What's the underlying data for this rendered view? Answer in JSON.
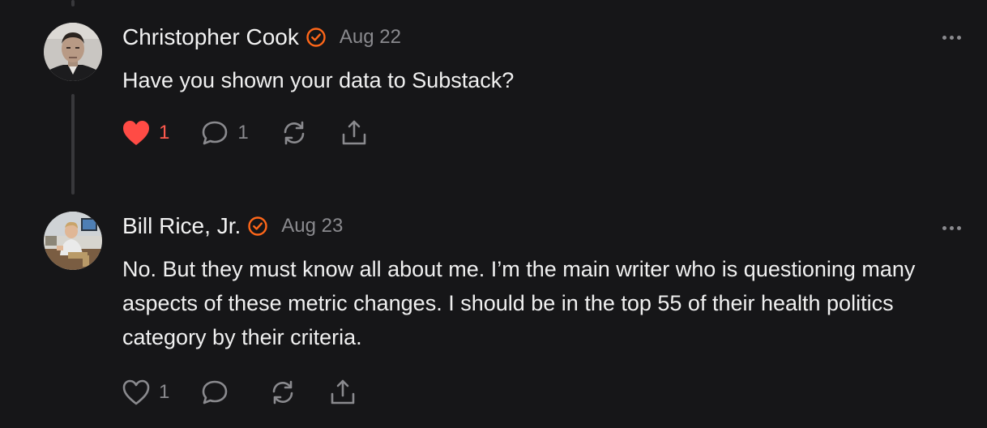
{
  "comments": [
    {
      "author": "Christopher Cook",
      "date": "Aug 22",
      "text": "Have you shown your data to Substack?",
      "likes": "1",
      "replies": "1",
      "liked": true,
      "avatar_icon": "man-portrait"
    },
    {
      "author": "Bill Rice, Jr.",
      "date": "Aug 23",
      "text": "No. But they must know all about me. I’m the main writer who is questioning many aspects of these metric changes. I should be in the top 55 of their health politics category by their criteria.",
      "likes": "1",
      "replies": "",
      "liked": false,
      "avatar_icon": "man-seated-office"
    }
  ],
  "colors": {
    "background": "#161618",
    "verified_badge": "#ff6719",
    "liked_heart": "#ff4b45",
    "muted": "#8a8a8e"
  },
  "icons": [
    "verified-badge-icon",
    "heart-icon",
    "comment-icon",
    "restack-icon",
    "share-icon",
    "more-icon"
  ]
}
